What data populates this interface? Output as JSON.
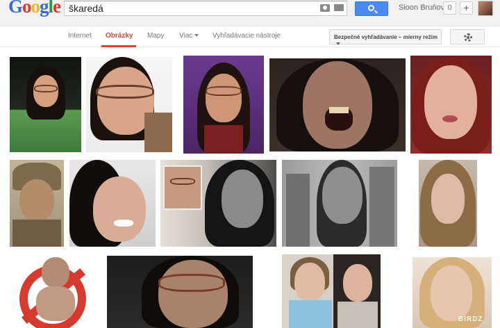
{
  "header": {
    "logo_text": "Google",
    "search_query": "škaredá",
    "user_name": "Sioon Bruňová",
    "notification_count": "0",
    "share_label": "+"
  },
  "nav": {
    "tabs": [
      "Internet",
      "Obrázky",
      "Mapy",
      "Viac",
      "Vyhľadávacie nástroje"
    ],
    "active_tab": "Obrázky",
    "safesearch_label": "Bezpečné vyhľadávanie – mierny režim"
  },
  "watermark": "BIRDZ",
  "colors": {
    "accent_red": "#d14836",
    "search_button_blue": "#4a8af4"
  }
}
